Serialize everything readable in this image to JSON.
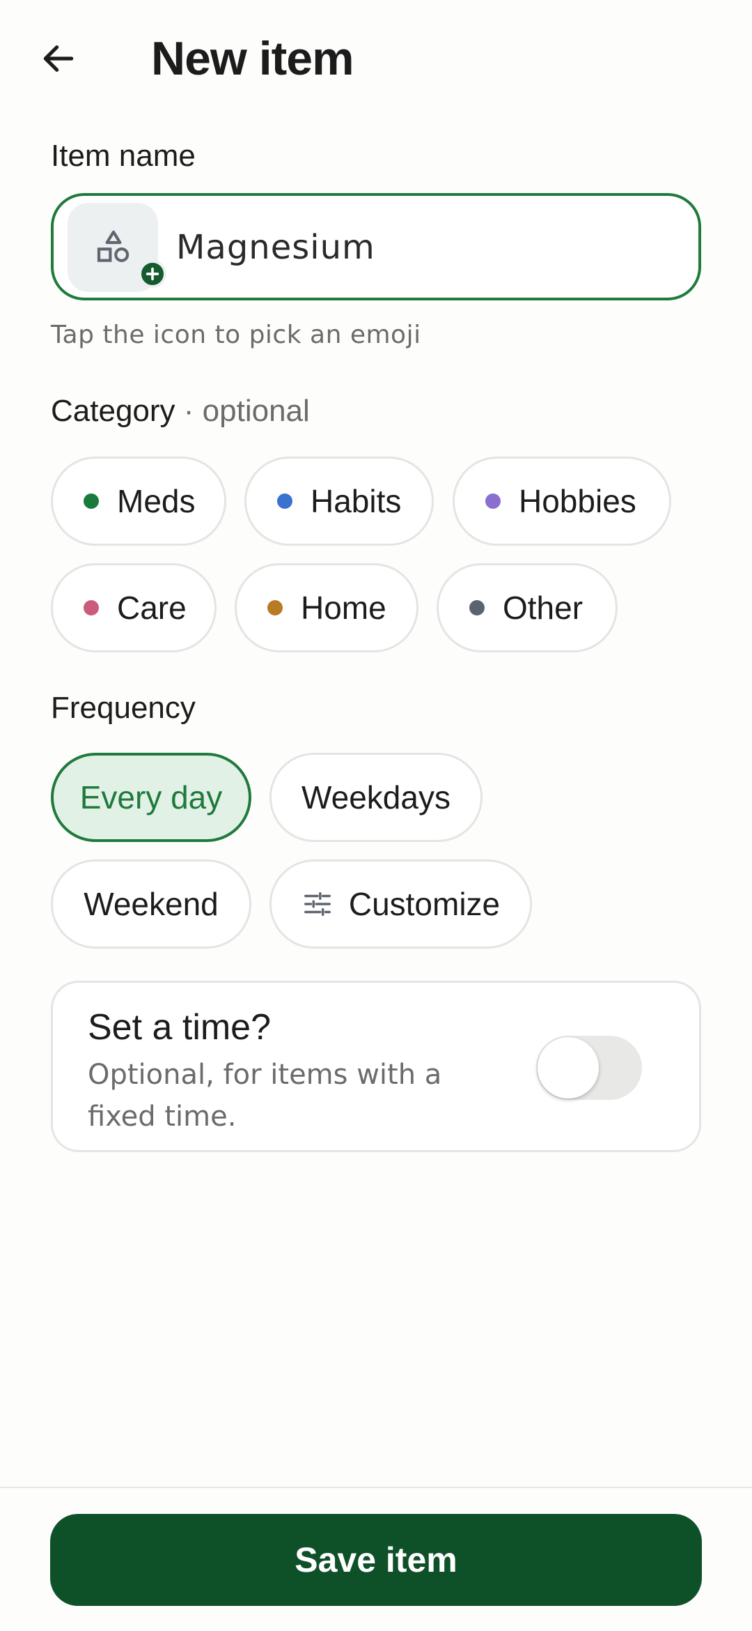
{
  "header": {
    "title": "New item",
    "back_icon": "arrow-left-icon"
  },
  "name_section": {
    "label": "Item name",
    "value": "Magnesium",
    "emoji_icon": "shapes-icon",
    "hint": "Tap the icon to pick an emoji"
  },
  "category_section": {
    "label": "Category",
    "optional": "· optional",
    "items": [
      {
        "label": "Meds",
        "color": "#1a7a3c"
      },
      {
        "label": "Habits",
        "color": "#3a72d0"
      },
      {
        "label": "Hobbies",
        "color": "#8a6fd0"
      },
      {
        "label": "Care",
        "color": "#cc5a7c"
      },
      {
        "label": "Home",
        "color": "#b87a24"
      },
      {
        "label": "Other",
        "color": "#5a6470"
      }
    ]
  },
  "frequency_section": {
    "label": "Frequency",
    "options": [
      {
        "label": "Every day",
        "selected": true
      },
      {
        "label": "Weekdays",
        "selected": false
      },
      {
        "label": "Weekend",
        "selected": false
      },
      {
        "label": "Customize",
        "selected": false,
        "icon": "tune-icon"
      }
    ]
  },
  "time_section": {
    "title": "Set a time?",
    "subtitle": "Optional, for items with a fixed time.",
    "enabled": false
  },
  "footer": {
    "save_label": "Save item"
  },
  "colors": {
    "accent": "#1f7a3c",
    "save_button": "#0e5128",
    "selected_chip_bg": "#e2f1e6"
  }
}
